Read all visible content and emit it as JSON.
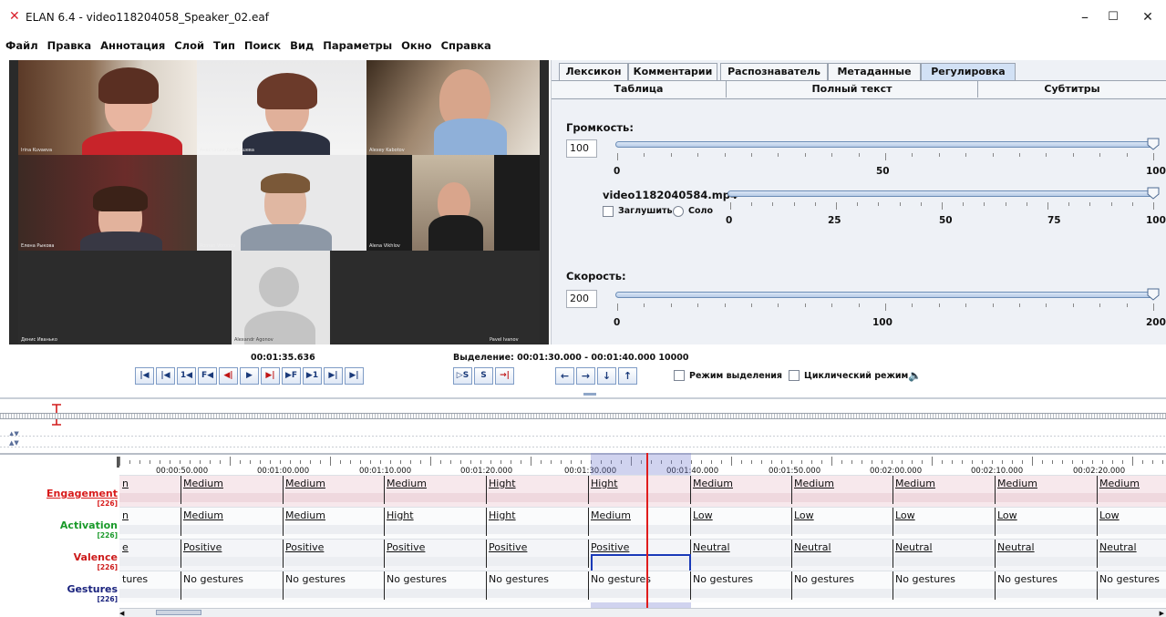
{
  "window": {
    "title": "ELAN 6.4 - video118204058_Speaker_02.eaf",
    "controls": [
      "–",
      "☐",
      "✕"
    ]
  },
  "menu": [
    "Файл",
    "Правка",
    "Аннотация",
    "Слой",
    "Тип",
    "Поиск",
    "Вид",
    "Параметры",
    "Окно",
    "Справка"
  ],
  "video": {
    "participants": [
      "Irina Kuvaeva",
      "Анастасия Дробышева",
      "Alexey Kabotov",
      "Елена Рыкова",
      "Roman Voronov",
      "Alena Vikhlov",
      "Денис Иванько",
      "Alexandr Agonov",
      "Pavel Ivanov"
    ]
  },
  "tabs_row1": [
    "Лексикон",
    "Комментарии",
    "Распознаватель",
    "Метаданные",
    "Регулировка"
  ],
  "tabs_row2": [
    "Таблица",
    "Полный текст",
    "Субтитры"
  ],
  "active_tab": "Регулировка",
  "volume": {
    "label": "Громкость:",
    "value": "100",
    "level": 1.0,
    "scale": [
      "0",
      "50",
      "100"
    ]
  },
  "media": {
    "file": "video1182040584.mp4",
    "mute_label": "Заглушить",
    "solo_label": "Соло",
    "level": 1.0,
    "scale": [
      "0",
      "25",
      "50",
      "75",
      "100"
    ]
  },
  "speed": {
    "label": "Скорость:",
    "value": "200",
    "level": 1.0,
    "scale": [
      "0",
      "100",
      "200"
    ]
  },
  "player": {
    "current_time": "00:01:35.636",
    "selection": "Выделение: 00:01:30.000 - 00:01:40.000  10000",
    "buttons": [
      "|◀",
      "|◀",
      "1◀",
      "F◀",
      "◀|",
      "▶",
      "▶|",
      "▶F",
      "▶1",
      "▶|",
      "▶|"
    ],
    "sel_buttons": [
      "▷S",
      "S",
      "→|"
    ],
    "nav_buttons": [
      "←",
      "→",
      "↓",
      "↑"
    ],
    "selection_mode": "Режим выделения",
    "loop_mode": "Циклический режим"
  },
  "ruler": [
    "00:00:50.000",
    "00:01:00.000",
    "00:01:10.000",
    "00:01:20.000",
    "00:01:30.000",
    "00:01:40.000",
    "00:01:50.000",
    "00:02:00.000",
    "00:02:10.000",
    "00:02:20.000"
  ],
  "tiers": [
    {
      "name": "Engagement",
      "count": "[226]",
      "color": "#d81b1b",
      "cells": [
        "n",
        "Medium",
        "Medium",
        "Medium",
        "Hight",
        "Hight",
        "Medium",
        "Medium",
        "Medium",
        "Medium",
        "Medium"
      ]
    },
    {
      "name": "Activation",
      "count": "[226]",
      "color": "#1a9a2a",
      "cells": [
        "n",
        "Medium",
        "Medium",
        "Hight",
        "Hight",
        "Medium",
        "Low",
        "Low",
        "Low",
        "Low",
        "Low"
      ]
    },
    {
      "name": "Valence",
      "count": "[226]",
      "color": "#cc1a1a",
      "cells": [
        "e",
        "Positive",
        "Positive",
        "Positive",
        "Positive",
        "Positive",
        "Neutral",
        "Neutral",
        "Neutral",
        "Neutral",
        "Neutral"
      ]
    },
    {
      "name": "Gestures",
      "count": "[226]",
      "color": "#1a237e",
      "cells": [
        "tures",
        "No gestures",
        "No gestures",
        "No gestures",
        "No gestures",
        "No gestures",
        "No gestures",
        "No gestures",
        "No gestures",
        "No gestures",
        "No gestures"
      ]
    }
  ]
}
